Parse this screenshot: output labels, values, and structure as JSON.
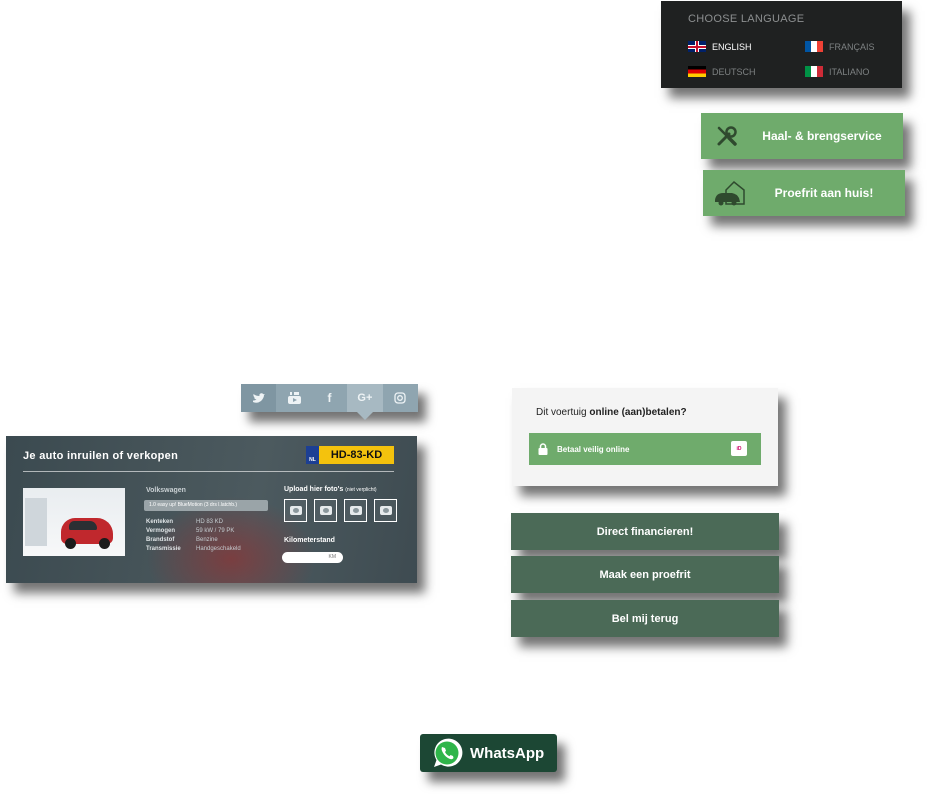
{
  "language": {
    "title": "CHOOSE LANGUAGE",
    "options": [
      {
        "label": "ENGLISH",
        "flag": "uk-flag-icon",
        "active": true
      },
      {
        "label": "FRANÇAIS",
        "flag": "fr-flag-icon",
        "active": false
      },
      {
        "label": "DEUTSCH",
        "flag": "de-flag-icon",
        "active": false
      },
      {
        "label": "ITALIANO",
        "flag": "it-flag-icon",
        "active": false
      }
    ]
  },
  "services": {
    "pickup_label": "Haal- & brengservice",
    "pickup_icon": "tools-icon",
    "testdrive_label": "Proefrit aan huis!",
    "testdrive_icon": "house-car-icon",
    "color": "#6fab6c"
  },
  "social": {
    "items": [
      "twitter-icon",
      "youtube-icon",
      "facebook-icon",
      "google-plus-icon",
      "instagram-icon"
    ],
    "active_index": 3,
    "glyphs": {
      "twitter": "🐦",
      "youtube": "▶",
      "facebook": "f",
      "google_plus": "G+",
      "instagram": "◎"
    }
  },
  "trade_in": {
    "title": "Je auto inruilen of verkopen",
    "plate_country": "NL",
    "plate": "HD-83-KD",
    "brand": "Volkswagen",
    "model": "1.0 easy up! BlueMotion (3 drs l.latchb.)",
    "specs": [
      {
        "key": "Kenteken",
        "value": "HD 83 KD"
      },
      {
        "key": "Vermogen",
        "value": "59 kW / 79 PK"
      },
      {
        "key": "Brandstof",
        "value": "Benzine"
      },
      {
        "key": "Transmissie",
        "value": "Handgeschakeld"
      }
    ],
    "upload_label": "Upload hier foto's",
    "upload_hint": "(niet verplicht)",
    "km_label": "Kilometerstand",
    "km_unit": "KM"
  },
  "payment": {
    "question_prefix": "Dit voertuig ",
    "question_bold": "online (aan)betalen?",
    "button_label": "Betaal veilig online",
    "ideal_label": "iD"
  },
  "actions": {
    "finance": "Direct financieren!",
    "testdrive": "Maak een proefrit",
    "callback": "Bel mij terug",
    "color": "#4b6a57"
  },
  "whatsapp": {
    "label": "WhatsApp",
    "color": "#1c4734"
  }
}
